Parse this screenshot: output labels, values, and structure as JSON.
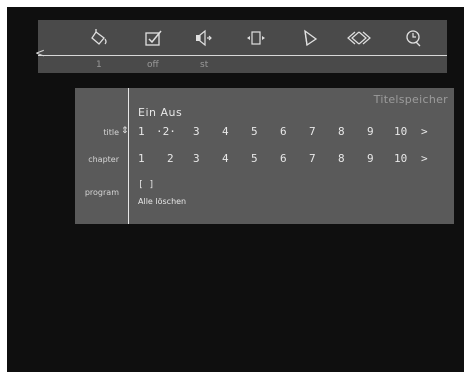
{
  "toolbar": {
    "icons": [
      {
        "name": "paint-bucket-icon"
      },
      {
        "name": "checkbox-icon"
      },
      {
        "name": "speaker-icon"
      },
      {
        "name": "frame-icon"
      },
      {
        "name": "play-icon"
      },
      {
        "name": "skip-icon"
      },
      {
        "name": "clock-icon"
      }
    ],
    "values": [
      "1",
      "off",
      "st"
    ]
  },
  "panel": {
    "title": "Titelspeicher",
    "ein_aus": "Ein Aus",
    "title_label": "title",
    "chapter_label": "chapter",
    "program_label": "program",
    "title_numbers": [
      "1",
      "·2·",
      "3",
      "4",
      "5",
      "6",
      "7",
      "8",
      "9",
      "10",
      ">"
    ],
    "chapter_numbers": [
      "1",
      "2",
      "3",
      "4",
      "5",
      "6",
      "7",
      "8",
      "9",
      "10",
      ">"
    ],
    "updown": "⇕",
    "program_value": "[ ]",
    "clear_all": "Alle löschen"
  },
  "colors": {
    "background": "#0f0f0f",
    "toolbar": "#4a4a4a",
    "panel": "#5a5a5a",
    "text": "#e8e8e8"
  }
}
